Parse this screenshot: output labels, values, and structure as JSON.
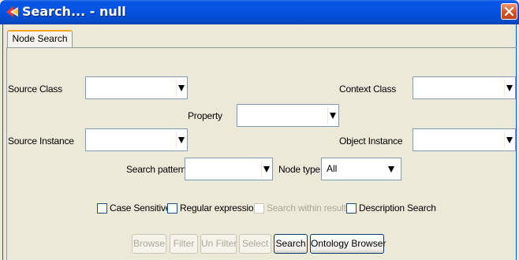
{
  "window": {
    "title": "Search... - null"
  },
  "tabs": [
    {
      "label": "Node Search",
      "selected": true
    }
  ],
  "form": {
    "source_class_label": "Source Class",
    "context_class_label": "Context Class",
    "property_label": "Property",
    "source_instance_label": "Source Instance",
    "object_instance_label": "Object Instance",
    "search_pattern_label": "Search pattern:",
    "node_type_label": "Node type:",
    "node_type_value": "All"
  },
  "options": {
    "case_sensitive": "Case Sensitive",
    "regular_expression": "Regular expression",
    "search_within_results": "Search within results",
    "description_search": "Description Search"
  },
  "buttons": {
    "browse": "Browse",
    "filter": "Filter",
    "un_filter": "Un Filter",
    "select": "Select",
    "search": "Search",
    "ontology_browser": "Ontology Browser"
  },
  "colors": {
    "titlebar": "#0553e0",
    "window_bg": "#ece9d8",
    "close_button": "#d9502a",
    "tab_highlight": "#f5a623"
  }
}
